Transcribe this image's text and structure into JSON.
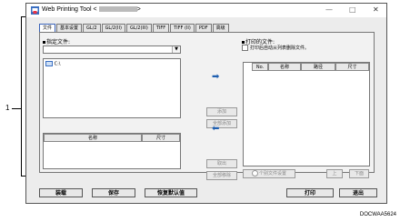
{
  "callout": {
    "number": "1"
  },
  "window": {
    "title": "Web Printing Tool <",
    "title_suffix": ">",
    "minimize_glyph": "—",
    "maximize_glyph": "□",
    "close_glyph": "✕"
  },
  "tabs": [
    {
      "label": "文件",
      "active": true
    },
    {
      "label": "基本设置"
    },
    {
      "label": "GL/2"
    },
    {
      "label": "GL/2(II)"
    },
    {
      "label": "GL/2(III)"
    },
    {
      "label": "TIFF"
    },
    {
      "label": "TIFF (II)"
    },
    {
      "label": "PDF"
    },
    {
      "label": "高级"
    }
  ],
  "left": {
    "section_label": "指定文件:",
    "combo_value": "",
    "tree_root": "C:\\",
    "table_headers": [
      "名称",
      "尺寸"
    ]
  },
  "middle": {
    "add_label": "添加",
    "add_all_label": "全部添加",
    "remove_label": "取出",
    "remove_all_label": "全部移除"
  },
  "right": {
    "section_label": "打印的文件:",
    "checkbox_label": "打印后自动从列表删除文件。",
    "table_headers": [
      "No.",
      "名称",
      "路径",
      "尺寸"
    ],
    "radio_label": "个别文件设置",
    "up_label": "上",
    "down_label": "下面"
  },
  "bottom": {
    "load_label": "装载",
    "save_label": "保存",
    "restore_label": "恢复默认值",
    "print_label": "打印",
    "exit_label": "退出"
  },
  "colors": {
    "accent": "#3b63b8",
    "arrow": "#1f5fb0"
  },
  "image_code": "DOCWAA5624"
}
